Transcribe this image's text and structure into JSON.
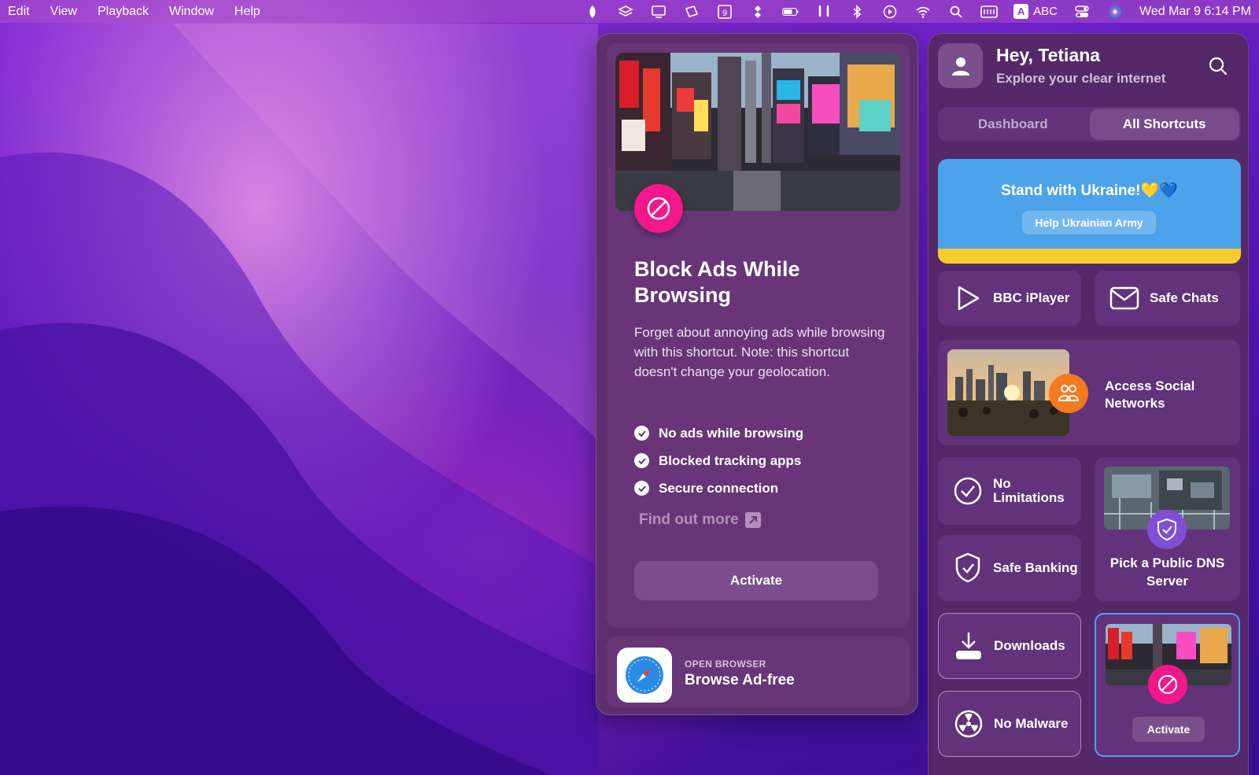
{
  "menubar": {
    "items": [
      "Edit",
      "View",
      "Playback",
      "Window",
      "Help"
    ],
    "input_source": "ABC",
    "datetime": "Wed Mar 9  6:14 PM",
    "calendar_day": "9"
  },
  "detail": {
    "title": "Block Ads While Browsing",
    "description": "Forget about annoying ads while browsing with this shortcut. Note: this shortcut doesn't change your geolocation.",
    "features": [
      "No ads while browsing",
      "Blocked tracking apps",
      "Secure connection"
    ],
    "find_out_more": "Find out more",
    "activate": "Activate",
    "browser_kicker": "OPEN BROWSER",
    "browser_title": "Browse Ad-free"
  },
  "sidebar": {
    "greeting": "Hey, Tetiana",
    "subtitle": "Explore your clear internet",
    "tabs": [
      "Dashboard",
      "All Shortcuts"
    ],
    "active_tab": "All Shortcuts",
    "banner": {
      "title": "Stand with Ukraine!💛💙",
      "button": "Help Ukrainian Army",
      "colors": {
        "blue": "#4da3ea",
        "yellow": "#f6cd2c"
      }
    },
    "shortcuts": {
      "bbc": "BBC iPlayer",
      "safe_chats": "Safe Chats",
      "social": "Access Social Networks",
      "no_limitations": "No Limitations",
      "dns": "Pick a Public DNS Server",
      "safe_banking": "Safe Banking",
      "downloads": "Downloads",
      "no_malware": "No Malware",
      "selected_activate": "Activate"
    }
  },
  "colors": {
    "accent_pink": "#f2178b",
    "social_orange": "#f47a1f",
    "dns_purple": "#7f4fd6",
    "selected_border": "#4da3ea"
  }
}
